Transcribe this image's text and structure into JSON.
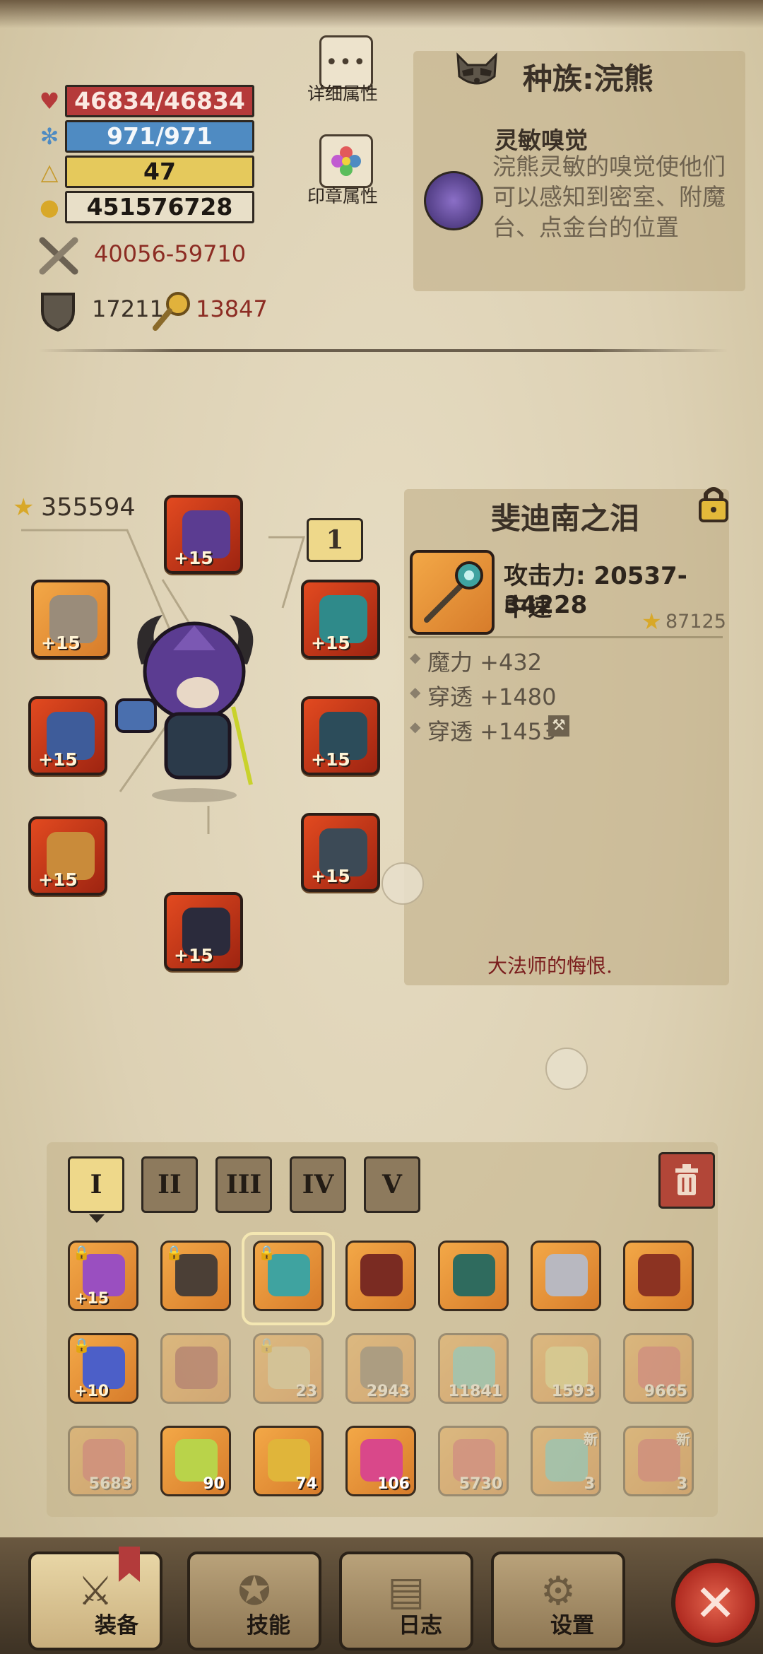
{
  "stats": {
    "hp": "46834/46834",
    "mp": "971/971",
    "level": "47",
    "gold": "451576728",
    "attack": "40056-59710",
    "defense": "17211",
    "penetration": "13847"
  },
  "buttons": {
    "detail_attrs": "详细属性",
    "seal_attrs": "印章属性"
  },
  "race": {
    "title": "种族:浣熊",
    "skill_name": "灵敏嗅觉",
    "skill_desc": "浣熊灵敏的嗅觉使他们可以感知到密室、附魔台、点金台的位置"
  },
  "equipment": {
    "score": "355594",
    "set_number": "1",
    "slots": [
      {
        "name": "helmet",
        "plus": "+15"
      },
      {
        "name": "ring-left",
        "plus": "+15"
      },
      {
        "name": "amulet",
        "plus": "+15"
      },
      {
        "name": "weapon-left",
        "plus": "+15"
      },
      {
        "name": "armor",
        "plus": "+15"
      },
      {
        "name": "gloves",
        "plus": "+15"
      },
      {
        "name": "boots",
        "plus": "+15"
      },
      {
        "name": "legs",
        "plus": "+15"
      }
    ]
  },
  "item": {
    "title": "斐迪南之泪",
    "attack": "攻击力: 20537-34228",
    "speed": "中速",
    "score": "87125",
    "affixes": [
      "魔力 +432",
      "穿透 +1480",
      "穿透 +1453"
    ],
    "quote": "大法师的悔恨."
  },
  "inventory": {
    "tabs": [
      "I",
      "II",
      "III",
      "IV",
      "V"
    ],
    "items": [
      {
        "plus": "+15",
        "count": "",
        "locked": true,
        "faded": false,
        "color": "#9a4fc0"
      },
      {
        "plus": "",
        "count": "",
        "locked": true,
        "faded": false,
        "color": "#4b3f36"
      },
      {
        "plus": "",
        "count": "",
        "locked": true,
        "faded": false,
        "color": "#3fa3a0"
      },
      {
        "plus": "",
        "count": "",
        "locked": false,
        "faded": false,
        "color": "#7a2b22"
      },
      {
        "plus": "",
        "count": "",
        "locked": false,
        "faded": false,
        "color": "#2f6b5e"
      },
      {
        "plus": "",
        "count": "",
        "locked": false,
        "faded": false,
        "color": "#b8b8c0"
      },
      {
        "plus": "",
        "count": "",
        "locked": false,
        "faded": false,
        "color": "#8c3322"
      },
      {
        "plus": "+10",
        "count": "",
        "locked": true,
        "faded": false,
        "color": "#4c5fc8"
      },
      {
        "plus": "",
        "count": "",
        "locked": false,
        "faded": true,
        "color": "#9a2f2a"
      },
      {
        "plus": "",
        "count": "23",
        "locked": true,
        "faded": true,
        "color": "#d9c48a"
      },
      {
        "plus": "",
        "count": "2943",
        "locked": false,
        "faded": true,
        "color": "#6a5a4a"
      },
      {
        "plus": "",
        "count": "11841",
        "locked": false,
        "faded": true,
        "color": "#5dc6c0"
      },
      {
        "plus": "",
        "count": "1593",
        "locked": false,
        "faded": true,
        "color": "#e4d97a"
      },
      {
        "plus": "",
        "count": "9665",
        "locked": false,
        "faded": true,
        "color": "#d94b4b"
      },
      {
        "plus": "",
        "count": "5683",
        "locked": false,
        "faded": true,
        "color": "#d94b4b"
      },
      {
        "plus": "",
        "count": "90",
        "locked": false,
        "faded": false,
        "color": "#b9d34a"
      },
      {
        "plus": "",
        "count": "74",
        "locked": false,
        "faded": false,
        "color": "#e0b53a"
      },
      {
        "plus": "",
        "count": "106",
        "locked": false,
        "faded": false,
        "color": "#d9488a"
      },
      {
        "plus": "",
        "count": "5730",
        "locked": false,
        "faded": true,
        "color": "#d94b4b"
      },
      {
        "plus": "",
        "count": "3",
        "locked": false,
        "faded": true,
        "color": "#5dc6c0",
        "new": "新"
      },
      {
        "plus": "",
        "count": "3",
        "locked": false,
        "faded": true,
        "color": "#d94b4b",
        "new": "新"
      }
    ]
  },
  "nav": {
    "equip": "装备",
    "skills": "技能",
    "log": "日志",
    "settings": "设置"
  },
  "colors": {
    "hp": "#b53a3a",
    "mp": "#4f8bc2",
    "level": "#e5c95c",
    "accent_red": "#8c2c23",
    "slot_red": "#e24a20",
    "slot_orange": "#f3a847"
  }
}
